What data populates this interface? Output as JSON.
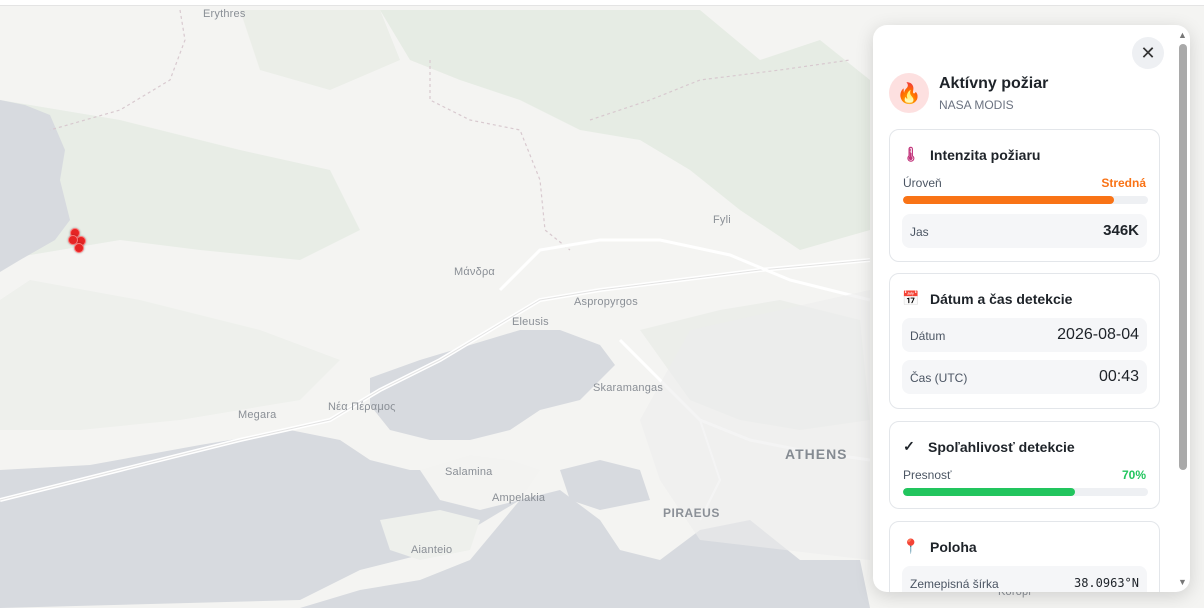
{
  "map": {
    "labels": {
      "erythres": "Erythres",
      "fyli": "Fyli",
      "mandra": "Μάνδρα",
      "aspropyrgos": "Aspropyrgos",
      "eleusis": "Eleusis",
      "megara": "Megara",
      "nea_peramos": "Νέα Πέραμος",
      "skaramangas": "Skaramangas",
      "athens": "ATHENS",
      "salamina": "Salamina",
      "ampelakia": "Ampelakia",
      "piraeus": "PIRAEUS",
      "aianteio": "Aianteio",
      "koropi": "Koropi"
    }
  },
  "panel": {
    "close_icon": "close-icon",
    "title": "Aktívny požiar",
    "subtitle": "NASA MODIS",
    "intensity": {
      "title": "Intenzita požiaru",
      "icon": "thermometer-icon",
      "level_label": "Úroveň",
      "level_value": "Stredná",
      "level_color": "#f97316",
      "level_fraction": 0.86,
      "brightness_label": "Jas",
      "brightness_value": "346K"
    },
    "datetime": {
      "title": "Dátum a čas detekcie",
      "icon": "calendar-icon",
      "date_label": "Dátum",
      "date_value": "2026-08-04",
      "time_label": "Čas (UTC)",
      "time_value": "00:43"
    },
    "confidence": {
      "title": "Spoľahlivosť detekcie",
      "icon": "checkmark-icon",
      "accuracy_label": "Presnosť",
      "accuracy_value": "70%",
      "accuracy_color": "#22c55e",
      "accuracy_fraction": 0.7
    },
    "location": {
      "title": "Poloha",
      "icon": "pin-icon",
      "lat_label": "Zemepisná šírka",
      "lat_value": "38.0963°N"
    }
  }
}
